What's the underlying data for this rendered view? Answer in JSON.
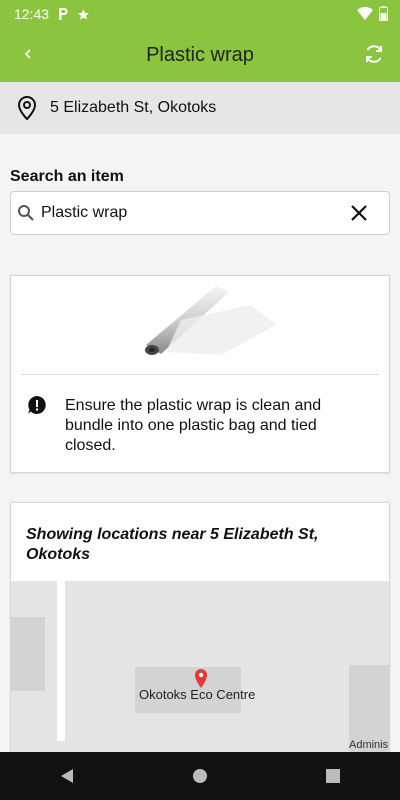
{
  "status_bar": {
    "time": "12:43"
  },
  "app_bar": {
    "title": "Plastic wrap"
  },
  "address": {
    "text": "5 Elizabeth St, Okotoks"
  },
  "search": {
    "label": "Search an item",
    "value": "Plastic wrap"
  },
  "item_card": {
    "instruction": "Ensure the plastic wrap is clean and bundle into one plastic bag and tied closed."
  },
  "locations_card": {
    "heading": "Showing locations near 5 Elizabeth St, Okotoks",
    "map": {
      "place_label": "Okotoks Eco Centre",
      "edge_label": "Adminis"
    }
  },
  "colors": {
    "accent": "#8bc53f",
    "address_bg": "#e6e6e6",
    "nav_bg": "#111111"
  },
  "icons": [
    "notification-p-icon",
    "star-icon",
    "wifi-icon",
    "battery-icon",
    "back-icon",
    "refresh-icon",
    "location-pin-icon",
    "search-icon",
    "clear-icon",
    "alert-icon",
    "map-marker-icon",
    "nav-back-icon",
    "nav-home-icon",
    "nav-recents-icon"
  ]
}
